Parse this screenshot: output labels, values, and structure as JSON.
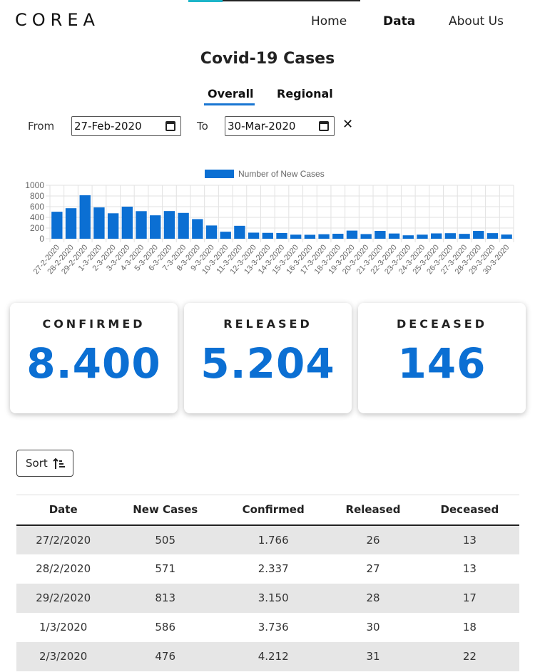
{
  "brand": "COREA",
  "nav": {
    "home": "Home",
    "data": "Data",
    "about": "About Us"
  },
  "page_title": "Covid-19 Cases",
  "tabs": {
    "overall": "Overall",
    "regional": "Regional"
  },
  "filter": {
    "from_label": "From",
    "from_value": "27-Feb-2020",
    "to_label": "To",
    "to_value": "30-Mar-2020",
    "clear": "✕"
  },
  "chart_data": {
    "type": "bar",
    "legend": "Number of New Cases",
    "legend_position": "top",
    "color": "#0b6fd3",
    "ylim": [
      0,
      1000
    ],
    "yticks": [
      0,
      200,
      400,
      600,
      800,
      1000
    ],
    "grid": true,
    "categories": [
      "27-2-2020",
      "28-2-2020",
      "29-2-2020",
      "1-3-2020",
      "2-3-2020",
      "3-3-2020",
      "4-3-2020",
      "5-3-2020",
      "6-3-2020",
      "7-3-2020",
      "8-3-2020",
      "9-3-2020",
      "10-3-2020",
      "11-3-2020",
      "12-3-2020",
      "13-3-2020",
      "14-3-2020",
      "15-3-2020",
      "16-3-2020",
      "17-3-2020",
      "18-3-2020",
      "19-3-2020",
      "20-3-2020",
      "21-3-2020",
      "22-3-2020",
      "23-3-2020",
      "24-3-2020",
      "25-3-2020",
      "26-3-2020",
      "27-3-2020",
      "28-3-2020",
      "29-3-2020",
      "30-3-2020"
    ],
    "values": [
      505,
      571,
      813,
      586,
      476,
      600,
      516,
      438,
      518,
      483,
      367,
      248,
      131,
      242,
      114,
      110,
      107,
      76,
      74,
      84,
      93,
      152,
      87,
      147,
      98,
      64,
      76,
      100,
      104,
      91,
      146,
      105,
      78
    ]
  },
  "cards": [
    {
      "label": "CONFIRMED",
      "value": "8.400"
    },
    {
      "label": "RELEASED",
      "value": "5.204"
    },
    {
      "label": "DECEASED",
      "value": "146"
    }
  ],
  "sort_label": "Sort",
  "table": {
    "headers": [
      "Date",
      "New Cases",
      "Confirmed",
      "Released",
      "Deceased"
    ],
    "rows": [
      [
        "27/2/2020",
        "505",
        "1.766",
        "26",
        "13"
      ],
      [
        "28/2/2020",
        "571",
        "2.337",
        "27",
        "13"
      ],
      [
        "29/2/2020",
        "813",
        "3.150",
        "28",
        "17"
      ],
      [
        "1/3/2020",
        "586",
        "3.736",
        "30",
        "18"
      ],
      [
        "2/3/2020",
        "476",
        "4.212",
        "31",
        "22"
      ]
    ]
  }
}
